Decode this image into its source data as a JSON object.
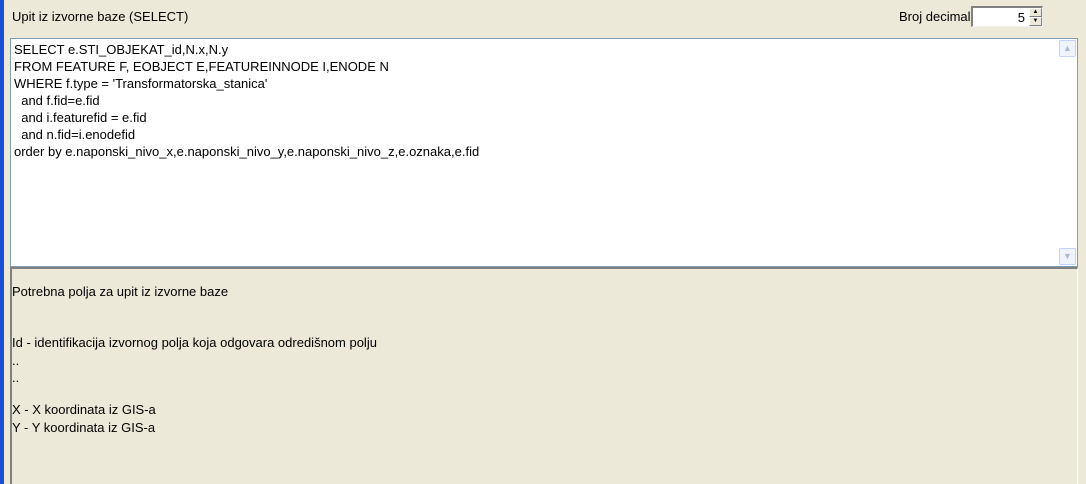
{
  "header": {
    "title": "Upit iz izvorne baze (SELECT)",
    "decimals_label": "Broj decimala",
    "decimals_value": "5"
  },
  "sql": {
    "lines": [
      "SELECT e.STI_OBJEKAT_id,N.x,N.y",
      "FROM FEATURE F, EOBJECT E,FEATUREINNODE I,ENODE N",
      "WHERE f.type = 'Transformatorska_stanica'",
      "  and f.fid=e.fid",
      "  and i.featurefid = e.fid",
      "  and n.fid=i.enodefid",
      "order by e.naponski_nivo_x,e.naponski_nivo_y,e.naponski_nivo_z,e.oznaka,e.fid"
    ]
  },
  "help": {
    "title": "Potrebna polja za upit iz izvorne baze",
    "line_id": "Id - identifikacija izvornog polja koja odgovara odredišnom polju",
    "dots1": "..",
    "dots2": "..",
    "line_x": "X - X koordinata iz GIS-a",
    "line_y": "Y - Y koordinata iz GIS-a"
  },
  "icons": {
    "spin_up": "spin-up-arrow-icon",
    "spin_down": "spin-down-arrow-icon",
    "scroll_up": "scroll-up-arrow-icon",
    "scroll_down": "scroll-down-arrow-icon"
  },
  "colors": {
    "panel_background": "#ECE9D8",
    "accent_bar": "#1B4FD6",
    "text_box_border": "#7F9DB9"
  }
}
